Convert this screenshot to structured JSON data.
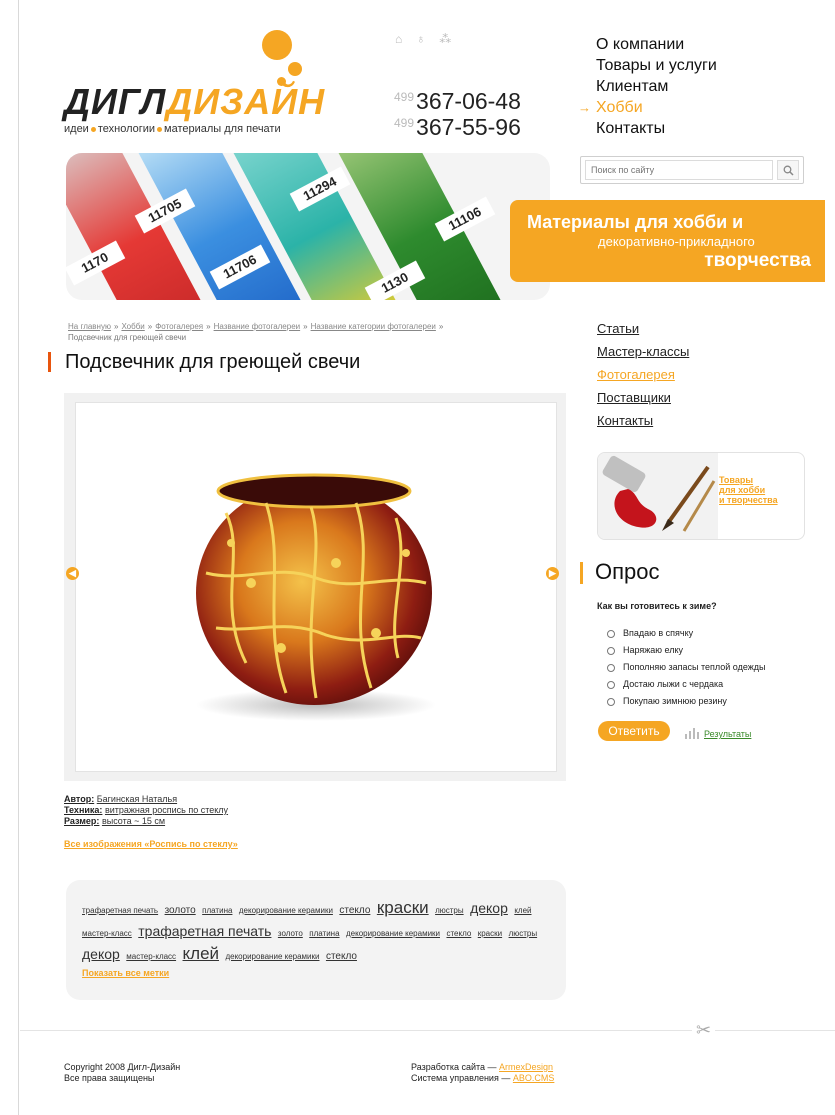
{
  "logo": {
    "part1": "ДИГЛ",
    "part2": "ДИЗАЙН",
    "tag1": "идеи",
    "tag2": "технологии",
    "tag3": "материалы для печати"
  },
  "top_icons": [
    "home-icon",
    "person-icon",
    "sitemap-icon"
  ],
  "phones": [
    {
      "code": "499",
      "number": "367-06-48"
    },
    {
      "code": "499",
      "number": "367-55-96"
    }
  ],
  "top_nav": {
    "items": [
      "О компании",
      "Товары и услуги",
      "Клиентам",
      "Хобби",
      "Контакты"
    ],
    "active_index": 3
  },
  "search": {
    "placeholder": "Поиск по сайту"
  },
  "banner": {
    "chips": [
      "11705",
      "11294",
      "11106",
      "11706",
      "1130",
      "1170"
    ],
    "promo_line1": "Материалы для хобби и",
    "promo_line2": "декоративно-прикладного",
    "promo_line3": "творчества"
  },
  "breadcrumb": {
    "items": [
      "На главную",
      "Хобби",
      "Фотогалерея",
      "Название фотогалереи",
      "Название категории фотогалереи"
    ],
    "separator": "»",
    "current": "Подсвечник для греющей свечи"
  },
  "page_title": "Подсвечник для греющей свечи",
  "meta": {
    "author_label": "Автор:",
    "author": "Багинская Наталья",
    "technique_label": "Техника:",
    "technique": "витражная роспись по стеклу",
    "size_label": "Размер:",
    "size": "высота ~ 15 см"
  },
  "all_images_link": "Все изображения «Роспись по стеклу»",
  "tags": [
    {
      "text": "трафаретная печать",
      "size": 1
    },
    {
      "text": "золото",
      "size": 2
    },
    {
      "text": "платина",
      "size": 1
    },
    {
      "text": "декорирование керамики",
      "size": 1
    },
    {
      "text": "стекло",
      "size": 2
    },
    {
      "text": "краски",
      "size": 4
    },
    {
      "text": "люстры",
      "size": 1
    },
    {
      "text": "декор",
      "size": 3
    },
    {
      "text": "клей",
      "size": 1
    },
    {
      "text": "мастер-класс",
      "size": 1
    },
    {
      "text": "трафаретная печать",
      "size": 3
    },
    {
      "text": "золото",
      "size": 1
    },
    {
      "text": "платина",
      "size": 1
    },
    {
      "text": "декорирование керамики",
      "size": 1
    },
    {
      "text": "стекло",
      "size": 1
    },
    {
      "text": "краски",
      "size": 1
    },
    {
      "text": "люстры",
      "size": 1
    },
    {
      "text": "декор",
      "size": 3
    },
    {
      "text": "мастер-класс",
      "size": 1
    },
    {
      "text": "клей",
      "size": 4
    },
    {
      "text": "декорирование керамики",
      "size": 1
    },
    {
      "text": "стекло",
      "size": 2
    }
  ],
  "show_all_tags": "Показать все метки",
  "side_nav": {
    "items": [
      "Статьи",
      "Мастер-классы",
      "Фотогалерея",
      "Поставщики",
      "Контакты"
    ],
    "active_index": 2
  },
  "side_promo": {
    "line1": "Товары",
    "line2": "для хобби",
    "line3": "и творчества"
  },
  "poll": {
    "title": "Опрос",
    "question": "Как вы готовитесь к зиме?",
    "options": [
      "Впадаю в спячку",
      "Наряжаю елку",
      "Пополняю запасы теплой одежды",
      "Достаю лыжи с чердака",
      "Покупаю зимнюю резину"
    ],
    "answer_button": "Ответить",
    "results_link": "Результаты"
  },
  "footer": {
    "copyright": "Copyright 2008 Дигл-Дизайн",
    "rights": "Все права защищены",
    "dev_label": "Разработка сайта —",
    "dev_link": "ArmexDesign",
    "cms_label": "Система управления —",
    "cms_link": "ABO.CMS"
  },
  "colors": {
    "accent": "#f5a623",
    "text": "#222222",
    "title_mark": "#e8550e",
    "results": "#3a8a2a"
  }
}
